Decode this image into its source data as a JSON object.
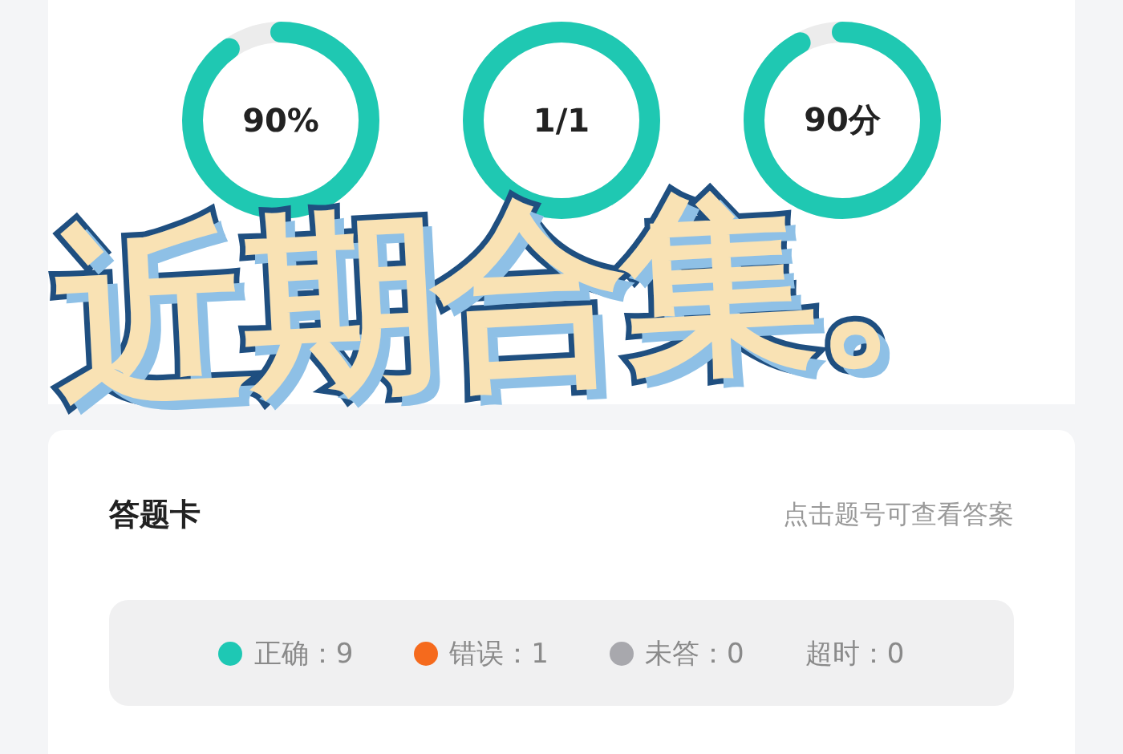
{
  "rings": [
    {
      "value": "90%",
      "level": 0.9
    },
    {
      "value": "1/1",
      "level": 1
    },
    {
      "value": "90分",
      "level": 0.92
    }
  ],
  "overlay_title": "近期合集。",
  "answer_card": {
    "title": "答题卡",
    "hint": "点击题号可查看答案",
    "legend": [
      {
        "label": "正确：9",
        "color": "#1ec8b4"
      },
      {
        "label": "错误：1",
        "color": "#f56a1d"
      },
      {
        "label": "未答：0",
        "color": "#a8a8ad"
      },
      {
        "label": "超时：0"
      }
    ]
  }
}
